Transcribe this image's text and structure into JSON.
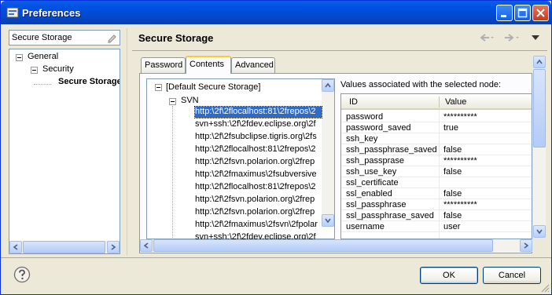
{
  "window": {
    "title": "Preferences"
  },
  "filter": {
    "value": "Secure Storage"
  },
  "nav_tree": [
    {
      "label": "General"
    },
    {
      "label": "Security"
    },
    {
      "label": "Secure Storage"
    }
  ],
  "page": {
    "title": "Secure Storage"
  },
  "tabs": [
    {
      "label": "Password"
    },
    {
      "label": "Contents"
    },
    {
      "label": "Advanced"
    }
  ],
  "storage_tree": {
    "root": "[Default Secure Storage]",
    "group": "SVN",
    "items": [
      "http:\\2f\\2flocalhost:81\\2frepos\\2",
      "svn+ssh:\\2f\\2fdev.eclipse.org\\2f",
      "http:\\2f\\2fsubclipse.tigris.org\\2fs",
      "http:\\2f\\2flocalhost:81\\2frepos\\2",
      "http:\\2f\\2fsvn.polarion.org\\2frep",
      "http:\\2f\\2fmaximus\\2fsubversive",
      "http:\\2f\\2flocalhost:81\\2frepos\\2",
      "http:\\2f\\2fsvn.polarion.org\\2frep",
      "http:\\2f\\2fsvn.polarion.org\\2frep",
      "http:\\2f\\2fmaximus\\2fsvn\\2fpolar",
      "svn+ssh:\\2f\\2fdev.eclipse.org\\2f"
    ]
  },
  "values": {
    "title": "Values associated with the selected node:",
    "columns": [
      "ID",
      "Value"
    ],
    "rows": [
      [
        "password",
        "**********"
      ],
      [
        "password_saved",
        "true"
      ],
      [
        "ssh_key",
        ""
      ],
      [
        "ssh_passphrase_saved",
        "false"
      ],
      [
        "ssh_passprase",
        "**********"
      ],
      [
        "ssh_use_key",
        "false"
      ],
      [
        "ssl_certificate",
        ""
      ],
      [
        "ssl_enabled",
        "false"
      ],
      [
        "ssl_passphrase",
        "**********"
      ],
      [
        "ssl_passphrase_saved",
        "false"
      ],
      [
        "username",
        "user"
      ]
    ]
  },
  "buttons": {
    "ok": "OK",
    "cancel": "Cancel"
  },
  "colors": {
    "titlebar": "#0050e3",
    "selection": "#316ac5",
    "tab_highlight": "#ffc83c"
  }
}
